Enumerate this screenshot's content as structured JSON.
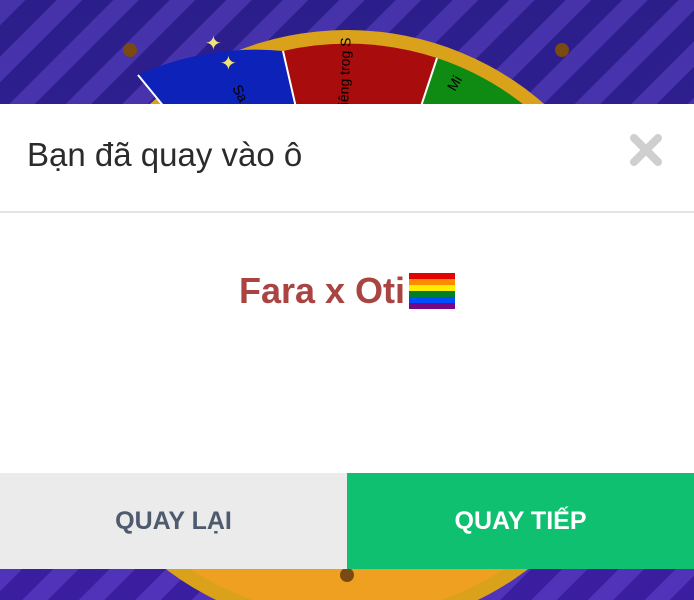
{
  "wheel": {
    "segment_labels": [
      "Sa",
      "riêng trog S",
      "Mi"
    ],
    "colors": {
      "blue": "#0c22b8",
      "red": "#a80c0c",
      "green": "#0f8a12",
      "rim": "#d9a21a",
      "orange": "#f0a020"
    }
  },
  "modal": {
    "title": "Bạn đã quay vào ô",
    "close_icon": "close-icon",
    "result_text": "Fara x Oti",
    "result_emoji": "rainbow-flag-icon"
  },
  "footer": {
    "back_label": "QUAY LẠI",
    "next_label": "QUAY TIẾP"
  },
  "colors": {
    "result_text": "#a94442",
    "next_button": "#0ec070",
    "back_button": "#ebebeb"
  }
}
